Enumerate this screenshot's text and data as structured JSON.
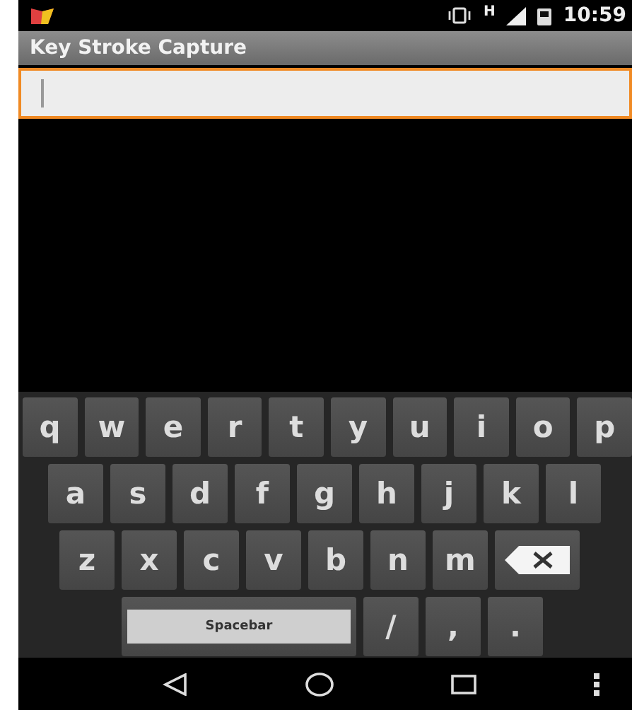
{
  "status_bar": {
    "network_type": "H",
    "time": "10:59"
  },
  "app_bar": {
    "title": "Key Stroke Capture"
  },
  "text_field": {
    "focused": true
  },
  "keyboard": {
    "rows": [
      {
        "keys": [
          {
            "kind": "char",
            "label": "q"
          },
          {
            "kind": "char",
            "label": "w"
          },
          {
            "kind": "char",
            "label": "e"
          },
          {
            "kind": "char",
            "label": "r"
          },
          {
            "kind": "char",
            "label": "t"
          },
          {
            "kind": "char",
            "label": "y"
          },
          {
            "kind": "char",
            "label": "u"
          },
          {
            "kind": "char",
            "label": "i"
          },
          {
            "kind": "char",
            "label": "o"
          },
          {
            "kind": "char",
            "label": "p"
          }
        ]
      },
      {
        "keys": [
          {
            "kind": "char",
            "label": "a"
          },
          {
            "kind": "char",
            "label": "s"
          },
          {
            "kind": "char",
            "label": "d"
          },
          {
            "kind": "char",
            "label": "f"
          },
          {
            "kind": "char",
            "label": "g"
          },
          {
            "kind": "char",
            "label": "h"
          },
          {
            "kind": "char",
            "label": "j"
          },
          {
            "kind": "char",
            "label": "k"
          },
          {
            "kind": "char",
            "label": "l"
          }
        ]
      },
      {
        "keys": [
          {
            "kind": "char",
            "label": "z"
          },
          {
            "kind": "char",
            "label": "x"
          },
          {
            "kind": "char",
            "label": "c"
          },
          {
            "kind": "char",
            "label": "v"
          },
          {
            "kind": "char",
            "label": "b"
          },
          {
            "kind": "char",
            "label": "n"
          },
          {
            "kind": "char",
            "label": "m"
          },
          {
            "kind": "backspace"
          }
        ]
      },
      {
        "keys": [
          {
            "kind": "space",
            "label": "Spacebar"
          },
          {
            "kind": "char",
            "label": "/"
          },
          {
            "kind": "char",
            "label": ","
          },
          {
            "kind": "char",
            "label": "."
          }
        ]
      }
    ]
  }
}
